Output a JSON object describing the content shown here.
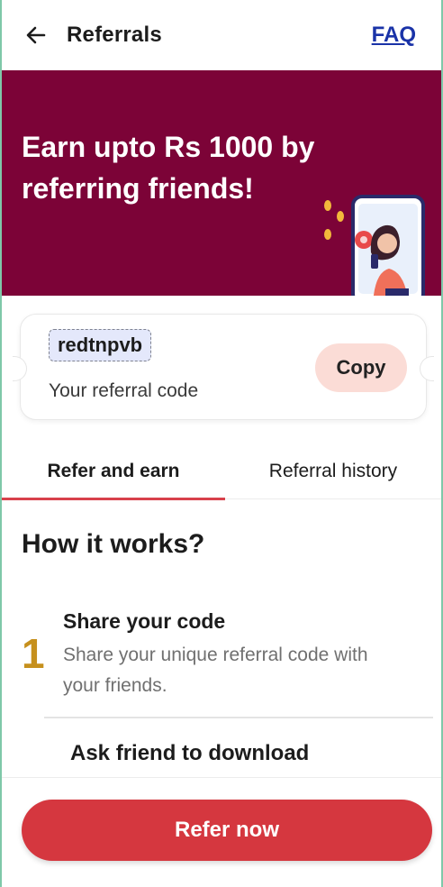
{
  "header": {
    "title": "Referrals",
    "faq_label": "FAQ",
    "back_icon": "arrow-left-icon"
  },
  "banner": {
    "headline": "Earn upto Rs 1000 by referring friends!",
    "background_color": "#7c0337",
    "illustration": "woman-with-phone-illustration"
  },
  "referral_code": {
    "code": "redtnpvb",
    "caption": "Your referral code",
    "copy_label": "Copy"
  },
  "tabs": [
    {
      "label": "Refer and earn",
      "active": true
    },
    {
      "label": "Referral history",
      "active": false
    }
  ],
  "how_it_works": {
    "title": "How it works?",
    "steps": [
      {
        "number": "1",
        "title": "Share your code",
        "description": "Share your unique referral code with your friends."
      },
      {
        "title": "Ask friend to download"
      }
    ]
  },
  "cta": {
    "label": "Refer now",
    "color": "#d5373f"
  },
  "colors": {
    "accent": "#d8414b",
    "link": "#1a33a8",
    "step_number": "#c6901d",
    "copy_button": "#fbdcd6",
    "code_chip": "#e4e8fb"
  }
}
